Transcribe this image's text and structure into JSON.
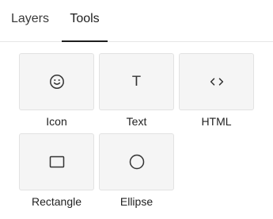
{
  "tabs": [
    {
      "label": "Layers",
      "active": false
    },
    {
      "label": "Tools",
      "active": true
    }
  ],
  "tools": [
    {
      "label": "Icon",
      "icon": "smiley-icon"
    },
    {
      "label": "Text",
      "icon": "text-icon",
      "glyph": "T"
    },
    {
      "label": "HTML",
      "icon": "code-icon"
    },
    {
      "label": "Rectangle",
      "icon": "rectangle-icon"
    },
    {
      "label": "Ellipse",
      "icon": "ellipse-icon"
    }
  ]
}
